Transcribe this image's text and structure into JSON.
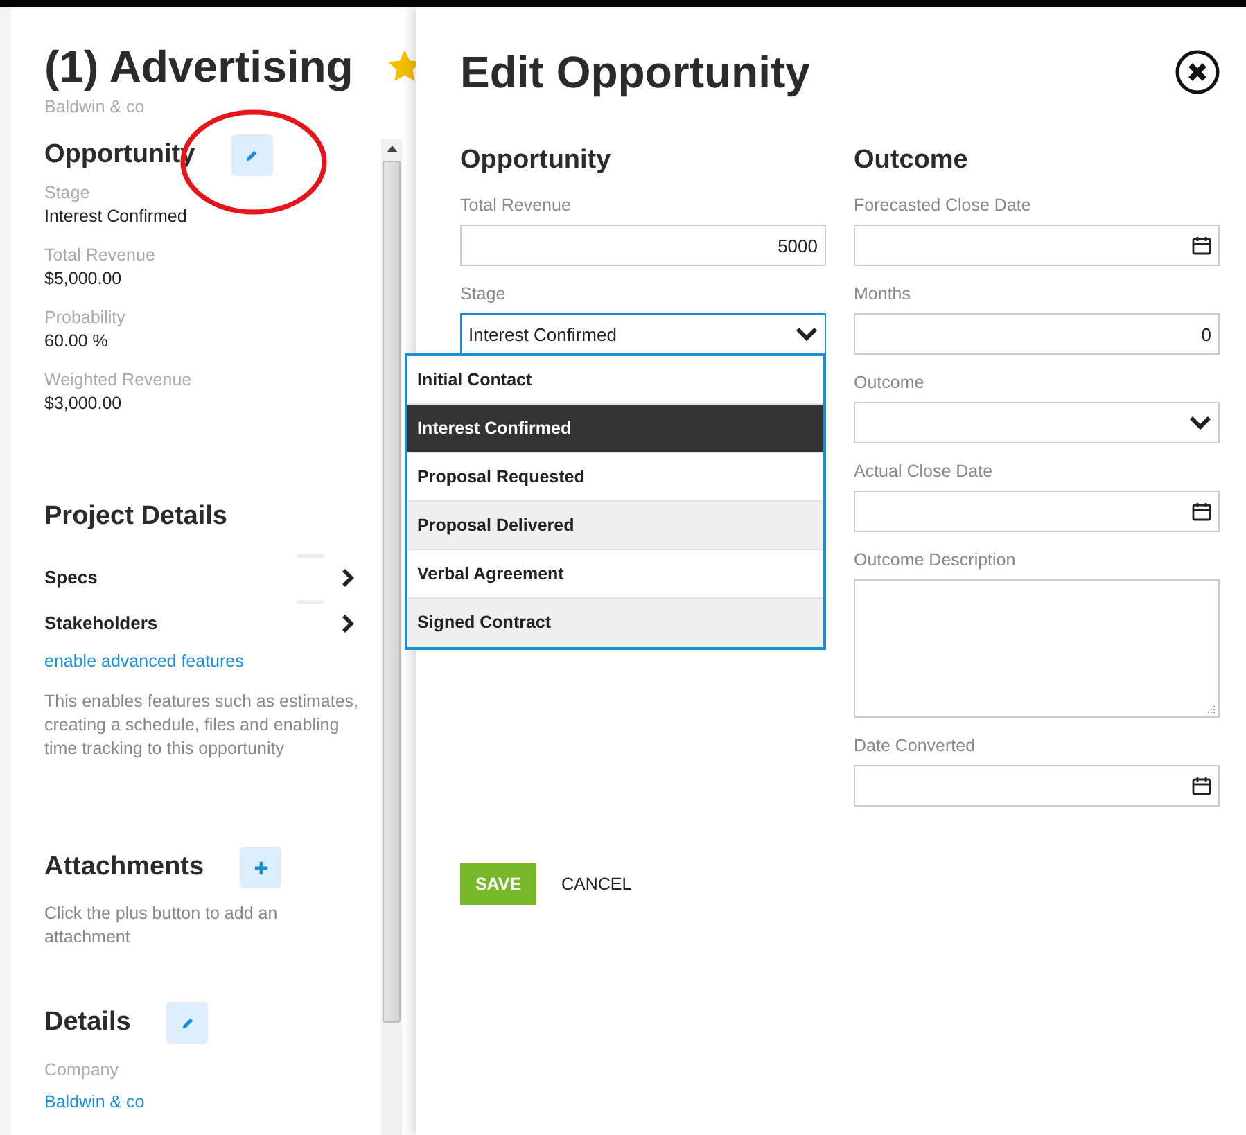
{
  "panel": {
    "title": "(1) Advertising",
    "starred": true,
    "company": "Baldwin & co",
    "opportunity": {
      "heading": "Opportunity",
      "fields": [
        {
          "label": "Stage",
          "value": "Interest Confirmed"
        },
        {
          "label": "Total Revenue",
          "value": "$5,000.00"
        },
        {
          "label": "Probability",
          "value": "60.00 %"
        },
        {
          "label": "Weighted Revenue",
          "value": "$3,000.00"
        }
      ]
    },
    "project_details": {
      "heading": "Project Details",
      "links": [
        {
          "label": "Specs"
        },
        {
          "label": "Stakeholders"
        }
      ],
      "advanced_link": "enable advanced features",
      "description": "This enables features such as estimates, creating a schedule, files and enabling time tracking to this opportunity"
    },
    "attachments": {
      "heading": "Attachments",
      "hint": "Click the plus button to add an attachment"
    },
    "details": {
      "heading": "Details",
      "fields": [
        {
          "label": "Company",
          "value": "Baldwin & co"
        }
      ]
    }
  },
  "dialog": {
    "title": "Edit Opportunity",
    "sections": [
      {
        "heading": "Opportunity",
        "fields": [
          {
            "kind": "text",
            "label": "Total Revenue",
            "value": "5000"
          },
          {
            "kind": "select",
            "label": "Stage",
            "value": "Interest Confirmed",
            "expanded": true
          }
        ]
      },
      {
        "heading": "Outcome",
        "fields": [
          {
            "kind": "date",
            "label": "Forecasted Close Date"
          },
          {
            "kind": "text",
            "label": "Months",
            "value": "0"
          },
          {
            "kind": "select",
            "label": "Outcome",
            "expanded": false
          },
          {
            "kind": "date",
            "label": "Actual Close Date"
          },
          {
            "kind": "textarea",
            "label": "Outcome Description"
          },
          {
            "kind": "date",
            "label": "Date Converted"
          }
        ]
      }
    ],
    "stage_options": [
      {
        "label": "Initial Contact",
        "selected": false
      },
      {
        "label": "Interest Confirmed",
        "selected": true
      },
      {
        "label": "Proposal Requested",
        "selected": false
      },
      {
        "label": "Proposal Delivered",
        "selected": false
      },
      {
        "label": "Verbal Agreement",
        "selected": false
      },
      {
        "label": "Signed Contract",
        "selected": false
      }
    ],
    "save": "SAVE",
    "cancel": "CANCEL"
  }
}
